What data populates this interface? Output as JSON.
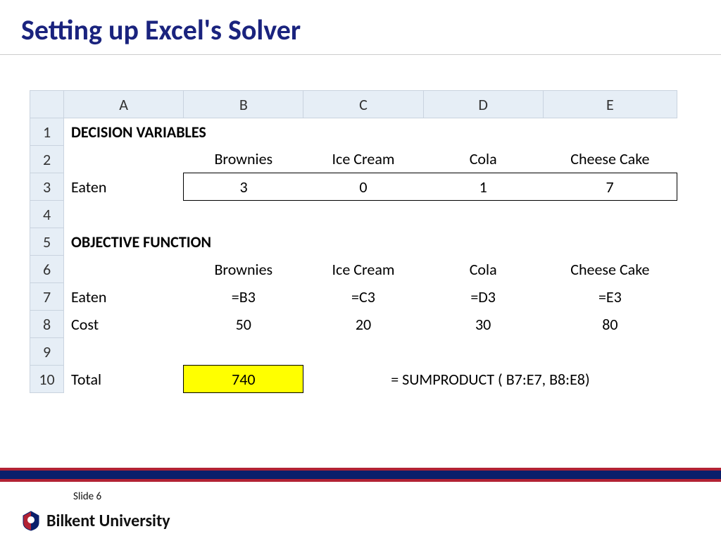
{
  "title": "Setting up Excel's Solver",
  "columns": [
    "A",
    "B",
    "C",
    "D",
    "E"
  ],
  "rows": {
    "1": {
      "section": "DECISION VARIABLES"
    },
    "2": {
      "labels": [
        "Brownies",
        "Ice Cream",
        "Cola",
        "Cheese Cake"
      ]
    },
    "3": {
      "label": "Eaten",
      "values": [
        "3",
        "0",
        "1",
        "7"
      ]
    },
    "5": {
      "section": "OBJECTIVE FUNCTION"
    },
    "6": {
      "labels": [
        "Brownies",
        "Ice Cream",
        "Cola",
        "Cheese Cake"
      ]
    },
    "7": {
      "label": "Eaten",
      "values": [
        "=B3",
        "=C3",
        "=D3",
        "=E3"
      ]
    },
    "8": {
      "label": "Cost",
      "values": [
        "50",
        "20",
        "30",
        "80"
      ]
    },
    "10": {
      "label": "Total",
      "total": "740",
      "formula": "= SUMPRODUCT ( B7:E7, B8:E8)"
    }
  },
  "footer": {
    "slide_label": "Slide 6",
    "university": "Bilkent University"
  }
}
